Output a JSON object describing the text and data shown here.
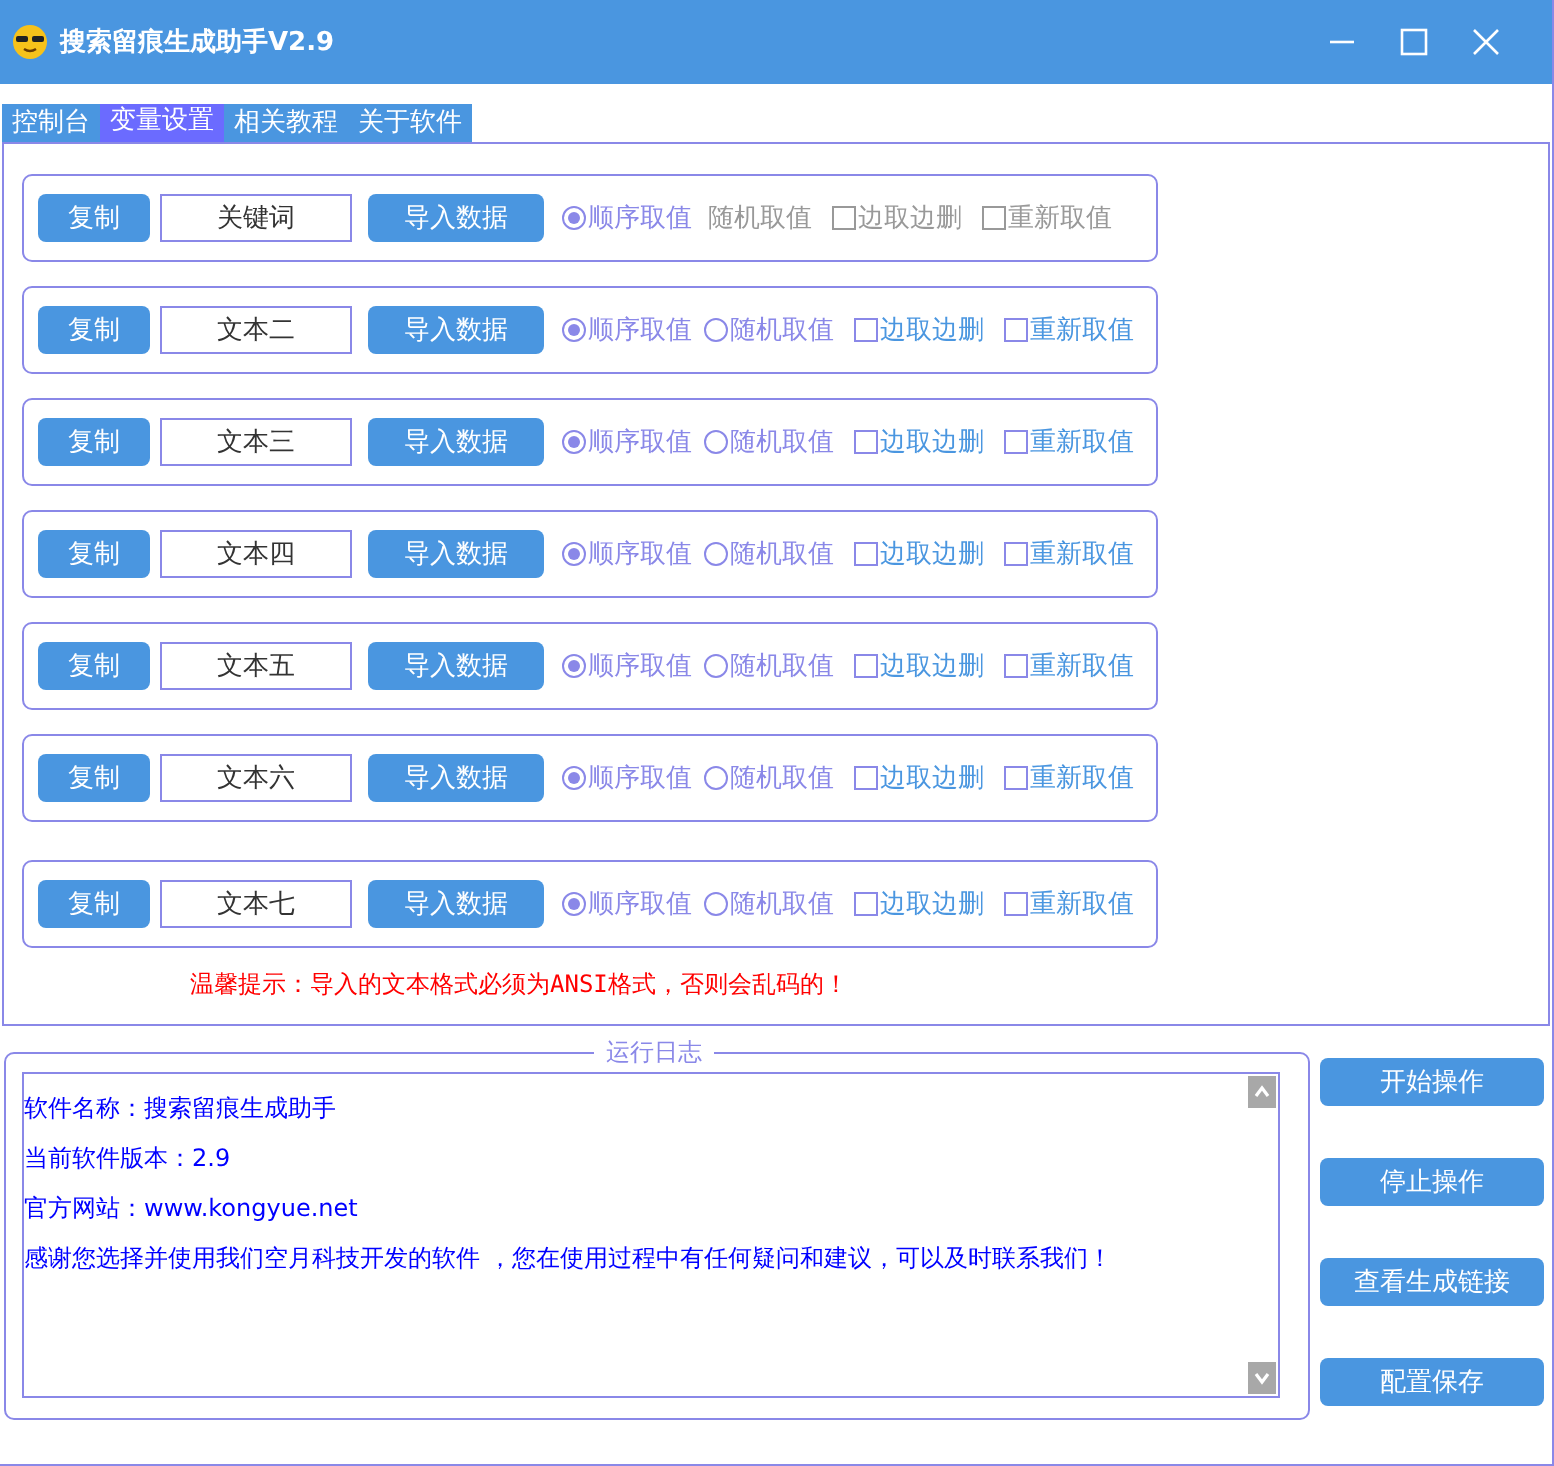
{
  "window": {
    "title": "搜索留痕生成助手V2.9"
  },
  "tabs": [
    {
      "label": "控制台",
      "selected": false
    },
    {
      "label": "变量设置",
      "selected": true
    },
    {
      "label": "相关教程",
      "selected": false
    },
    {
      "label": "关于软件",
      "selected": false
    }
  ],
  "variables": [
    {
      "copy": "复制",
      "value": "关键词",
      "import": "导入数据",
      "sequential": {
        "label": "顺序取值",
        "selected": true
      },
      "random": {
        "label": "随机取值",
        "selected": false,
        "disabled": true
      },
      "edge_delete": {
        "label": "边取边删",
        "checked": false,
        "disabled": true
      },
      "refetch": {
        "label": "重新取值",
        "checked": false,
        "disabled": true
      }
    },
    {
      "copy": "复制",
      "value": "文本二",
      "import": "导入数据",
      "sequential": {
        "label": "顺序取值",
        "selected": true
      },
      "random": {
        "label": "随机取值",
        "selected": false,
        "disabled": false
      },
      "edge_delete": {
        "label": "边取边删",
        "checked": false,
        "disabled": false
      },
      "refetch": {
        "label": "重新取值",
        "checked": false,
        "disabled": false
      }
    },
    {
      "copy": "复制",
      "value": "文本三",
      "import": "导入数据",
      "sequential": {
        "label": "顺序取值",
        "selected": true
      },
      "random": {
        "label": "随机取值",
        "selected": false,
        "disabled": false
      },
      "edge_delete": {
        "label": "边取边删",
        "checked": false,
        "disabled": false
      },
      "refetch": {
        "label": "重新取值",
        "checked": false,
        "disabled": false
      }
    },
    {
      "copy": "复制",
      "value": "文本四",
      "import": "导入数据",
      "sequential": {
        "label": "顺序取值",
        "selected": true
      },
      "random": {
        "label": "随机取值",
        "selected": false,
        "disabled": false
      },
      "edge_delete": {
        "label": "边取边删",
        "checked": false,
        "disabled": false
      },
      "refetch": {
        "label": "重新取值",
        "checked": false,
        "disabled": false
      }
    },
    {
      "copy": "复制",
      "value": "文本五",
      "import": "导入数据",
      "sequential": {
        "label": "顺序取值",
        "selected": true
      },
      "random": {
        "label": "随机取值",
        "selected": false,
        "disabled": false
      },
      "edge_delete": {
        "label": "边取边删",
        "checked": false,
        "disabled": false
      },
      "refetch": {
        "label": "重新取值",
        "checked": false,
        "disabled": false
      }
    },
    {
      "copy": "复制",
      "value": "文本六",
      "import": "导入数据",
      "sequential": {
        "label": "顺序取值",
        "selected": true
      },
      "random": {
        "label": "随机取值",
        "selected": false,
        "disabled": false
      },
      "edge_delete": {
        "label": "边取边删",
        "checked": false,
        "disabled": false
      },
      "refetch": {
        "label": "重新取值",
        "checked": false,
        "disabled": false
      }
    },
    {
      "copy": "复制",
      "value": "文本七",
      "import": "导入数据",
      "sequential": {
        "label": "顺序取值",
        "selected": true
      },
      "random": {
        "label": "随机取值",
        "selected": false,
        "disabled": false
      },
      "edge_delete": {
        "label": "边取边删",
        "checked": false,
        "disabled": false
      },
      "refetch": {
        "label": "重新取值",
        "checked": false,
        "disabled": false
      }
    }
  ],
  "warning": "温馨提示：导入的文本格式必须为ANSI格式，否则会乱码的！",
  "log": {
    "title": "运行日志",
    "lines": [
      "软件名称：搜索留痕生成助手",
      "当前软件版本：2.9",
      "官方网站：www.kongyue.net",
      "感谢您选择并使用我们空月科技开发的软件 ，您在使用过程中有任何疑问和建议，可以及时联系我们！"
    ]
  },
  "actions": [
    "开始操作",
    "停止操作",
    "查看生成链接",
    "配置保存"
  ]
}
